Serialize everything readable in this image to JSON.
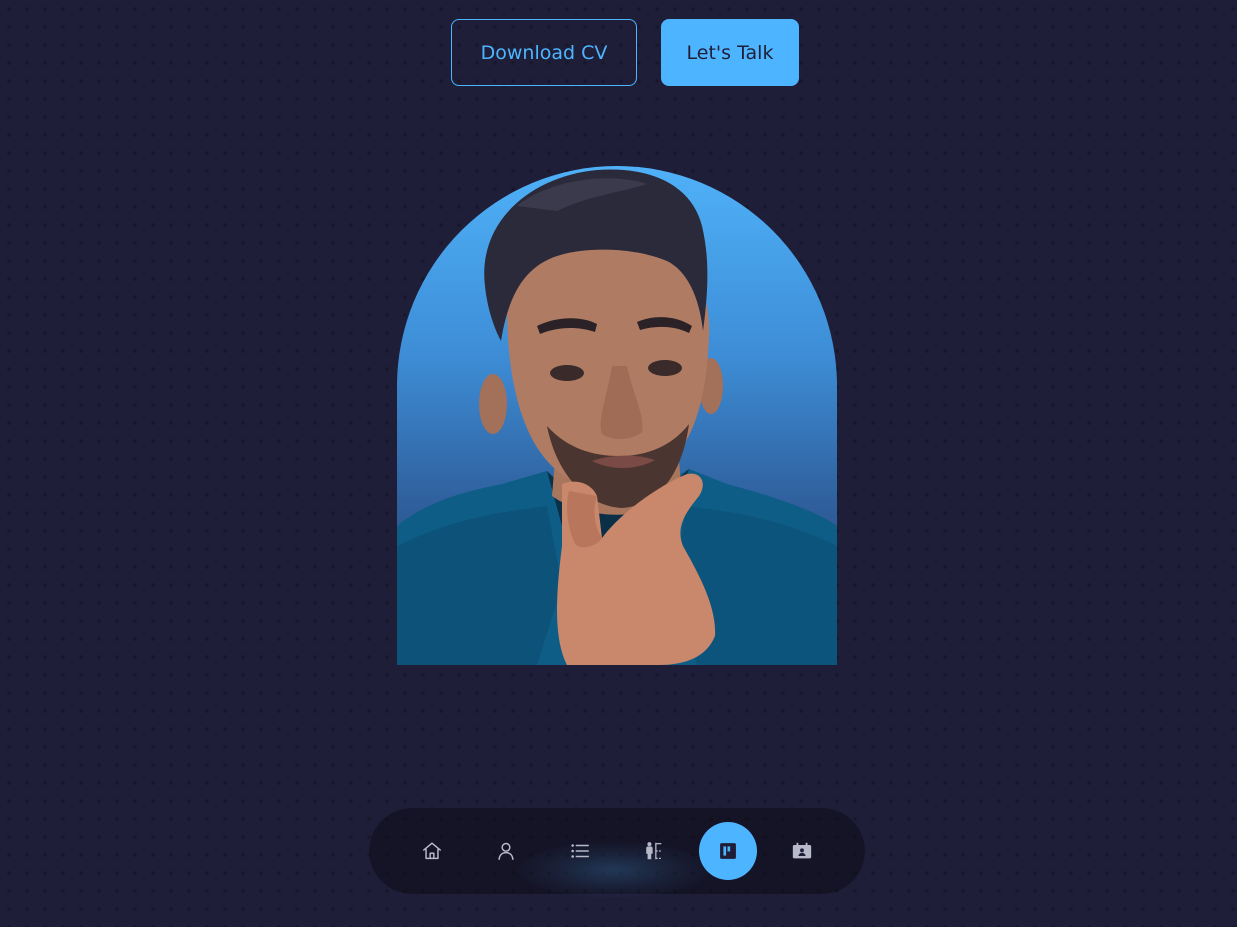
{
  "hero": {
    "download_cv_label": "Download CV",
    "lets_talk_label": "Let's Talk"
  },
  "portrait": {
    "subject": "person-portrait"
  },
  "bottom_nav": {
    "items": [
      {
        "icon": "home-icon",
        "active": false
      },
      {
        "icon": "user-icon",
        "active": false
      },
      {
        "icon": "list-icon",
        "active": false
      },
      {
        "icon": "experience-icon",
        "active": false
      },
      {
        "icon": "portfolio-icon",
        "active": true
      },
      {
        "icon": "contact-icon",
        "active": false
      }
    ]
  },
  "colors": {
    "background": "#1f1e38",
    "accent": "#4db5ff",
    "icon_default": "#b7b9c9",
    "icon_active": "#1f1e38"
  }
}
